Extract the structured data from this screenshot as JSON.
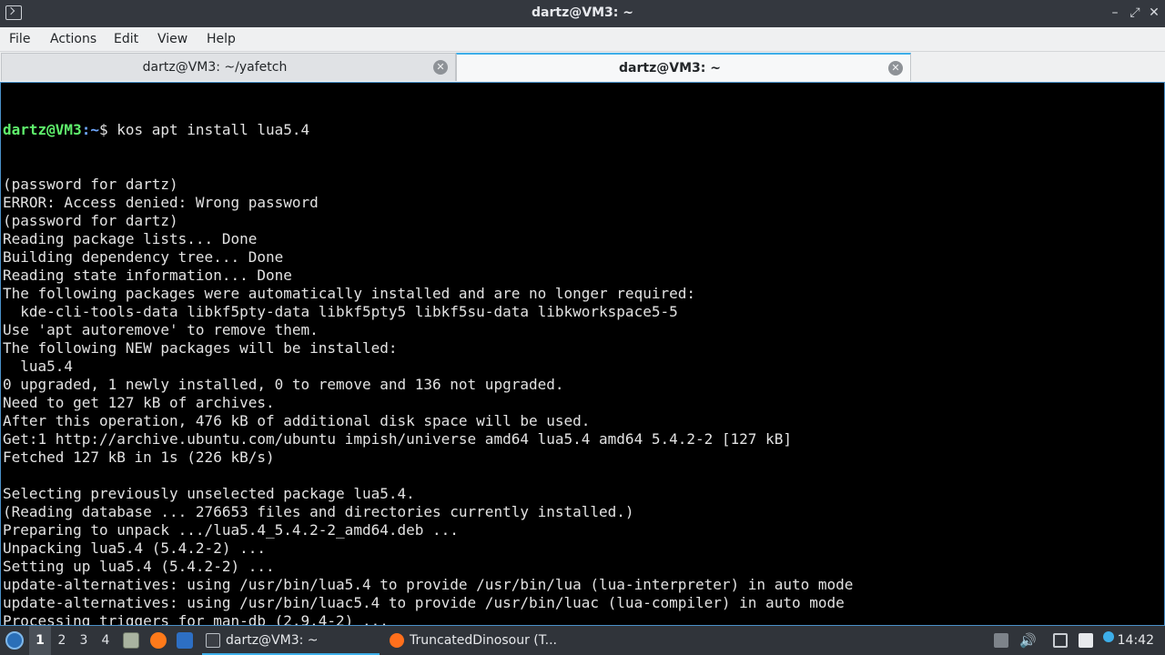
{
  "window": {
    "title": "dartz@VM3: ~"
  },
  "menubar": {
    "items": [
      "File",
      "Actions",
      "Edit",
      "View",
      "Help"
    ]
  },
  "tabs": [
    {
      "label": "dartz@VM3: ~/yafetch",
      "active": false
    },
    {
      "label": "dartz@VM3: ~",
      "active": true
    }
  ],
  "terminal": {
    "prompt_user": "dartz@VM3",
    "prompt_path": ":~",
    "prompt_symbol": "$ ",
    "command": "kos apt install lua5.4",
    "output": [
      "(password for dartz)",
      "ERROR: Access denied: Wrong password",
      "(password for dartz)",
      "Reading package lists... Done",
      "Building dependency tree... Done",
      "Reading state information... Done",
      "The following packages were automatically installed and are no longer required:",
      "  kde-cli-tools-data libkf5pty-data libkf5pty5 libkf5su-data libkworkspace5-5",
      "Use 'apt autoremove' to remove them.",
      "The following NEW packages will be installed:",
      "  lua5.4",
      "0 upgraded, 1 newly installed, 0 to remove and 136 not upgraded.",
      "Need to get 127 kB of archives.",
      "After this operation, 476 kB of additional disk space will be used.",
      "Get:1 http://archive.ubuntu.com/ubuntu impish/universe amd64 lua5.4 amd64 5.4.2-2 [127 kB]",
      "Fetched 127 kB in 1s (226 kB/s)",
      "",
      "Selecting previously unselected package lua5.4.",
      "(Reading database ... 276653 files and directories currently installed.)",
      "Preparing to unpack .../lua5.4_5.4.2-2_amd64.deb ...",
      "Unpacking lua5.4 (5.4.2-2) ...",
      "Setting up lua5.4 (5.4.2-2) ...",
      "update-alternatives: using /usr/bin/lua5.4 to provide /usr/bin/lua (lua-interpreter) in auto mode",
      "update-alternatives: using /usr/bin/luac5.4 to provide /usr/bin/luac (lua-compiler) in auto mode",
      "Processing triggers for man-db (2.9.4-2) ..."
    ]
  },
  "taskbar": {
    "workspaces": [
      "1",
      "2",
      "3",
      "4"
    ],
    "current_workspace": "1",
    "tasks": [
      {
        "label": "dartz@VM3: ~",
        "icon": "terminal-icon",
        "active": true
      },
      {
        "label": "TruncatedDinosour (T...",
        "icon": "firefox-icon",
        "active": false
      }
    ],
    "clock": "14:42"
  },
  "colors": {
    "accent": "#3daee9",
    "prompt_user": "#5ff06c",
    "prompt_path": "#6fa8ff",
    "terminal_bg": "#000000"
  }
}
